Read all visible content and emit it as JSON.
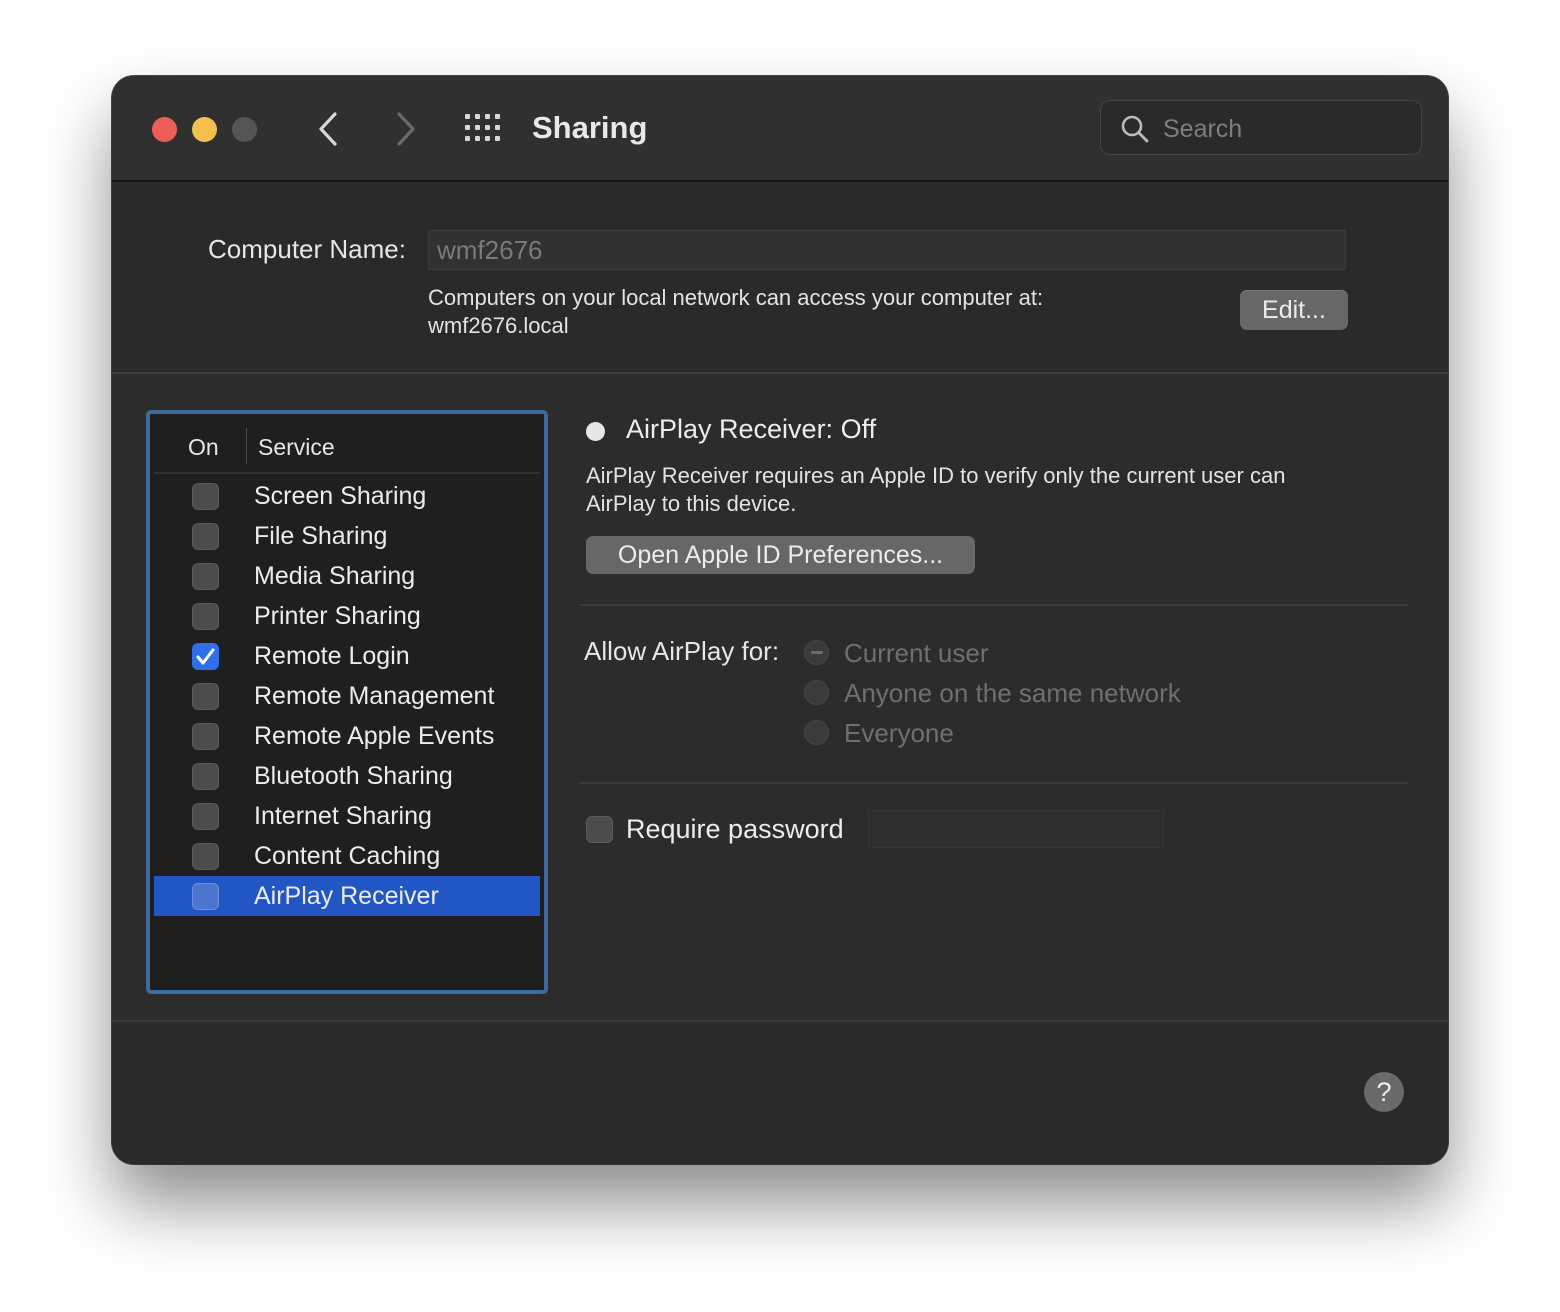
{
  "window": {
    "title": "Sharing",
    "search_placeholder": "Search"
  },
  "computer": {
    "name_label": "Computer Name:",
    "name_value": "wmf2676",
    "desc_line1": "Computers on your local network can access your computer at:",
    "desc_line2": "wmf2676.local",
    "edit_label": "Edit..."
  },
  "services": {
    "header_on": "On",
    "header_service": "Service",
    "items": [
      {
        "label": "Screen Sharing",
        "checked": false
      },
      {
        "label": "File Sharing",
        "checked": false
      },
      {
        "label": "Media Sharing",
        "checked": false
      },
      {
        "label": "Printer Sharing",
        "checked": false
      },
      {
        "label": "Remote Login",
        "checked": true
      },
      {
        "label": "Remote Management",
        "checked": false
      },
      {
        "label": "Remote Apple Events",
        "checked": false
      },
      {
        "label": "Bluetooth Sharing",
        "checked": false
      },
      {
        "label": "Internet Sharing",
        "checked": false
      },
      {
        "label": "Content Caching",
        "checked": false
      },
      {
        "label": "AirPlay Receiver",
        "checked": false,
        "selected": true
      }
    ]
  },
  "detail": {
    "status": "AirPlay Receiver: Off",
    "desc_line1": "AirPlay Receiver requires an Apple ID to verify only the current user can",
    "desc_line2": "AirPlay to this device.",
    "apple_id_button": "Open Apple ID Preferences...",
    "allow_label": "Allow AirPlay for:",
    "options": [
      "Current user",
      "Anyone on the same network",
      "Everyone"
    ],
    "require_password_label": "Require password"
  },
  "help_label": "?",
  "colors": {
    "close": "#ec5f59",
    "minimize": "#f4bf4f",
    "zoom": "#555556",
    "selection": "#2356c5",
    "focus_ring": "#3d6c9c",
    "checkbox_on": "#2f6fe8"
  }
}
